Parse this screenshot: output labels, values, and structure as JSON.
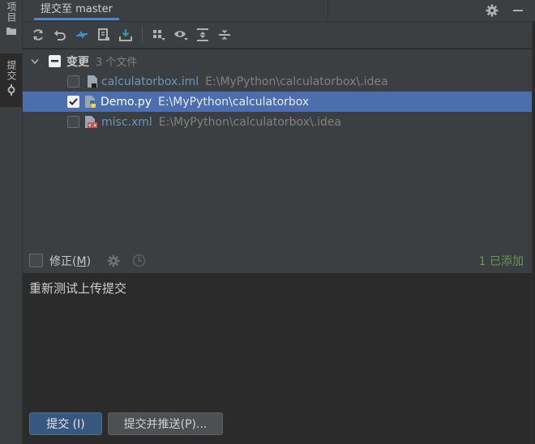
{
  "side": {
    "project_label": "项目",
    "commit_label": "提交"
  },
  "header": {
    "tab_title": "提交至 master"
  },
  "toolbar": {
    "icons": [
      "refresh-icon",
      "rollback-icon",
      "diff-icon",
      "shelve-icon",
      "update-icon",
      "group-by-icon",
      "view-options-icon",
      "expand-all-icon",
      "collapse-all-icon"
    ]
  },
  "changes": {
    "group_label": "变更",
    "group_count": "3 个文件",
    "files": [
      {
        "name": "calculatorbox.iml",
        "path": "E:\\MyPython\\calculatorbox\\.idea",
        "checked": false,
        "selected": false,
        "icon": "iml-file-icon"
      },
      {
        "name": "Demo.py",
        "path": "E:\\MyPython\\calculatorbox",
        "checked": true,
        "selected": true,
        "icon": "python-file-icon"
      },
      {
        "name": "misc.xml",
        "path": "E:\\MyPython\\calculatorbox\\.idea",
        "checked": false,
        "selected": false,
        "icon": "xml-file-icon"
      }
    ]
  },
  "amend": {
    "label": "修正(",
    "mnemonic": "M",
    "label_end": ")",
    "added_status": "1 已添加"
  },
  "commit_message": "重新测试上传提交",
  "buttons": {
    "commit": "提交 (I)",
    "commit_push": "提交并推送(P)..."
  },
  "colors": {
    "accent": "#4b6eaf",
    "added_green": "#629755",
    "file_blue": "#6897bb"
  }
}
